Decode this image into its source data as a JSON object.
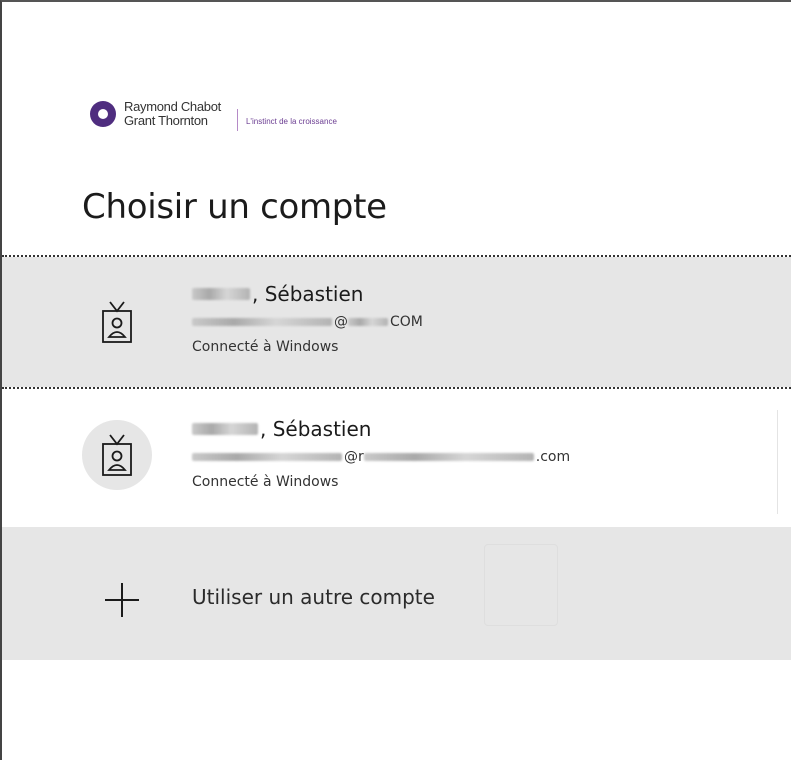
{
  "logo": {
    "line1": "Raymond Chabot",
    "line2": "Grant Thornton",
    "tagline": "L'instinct de la croissance"
  },
  "title": "Choisir un compte",
  "accounts": [
    {
      "name_suffix": ", Sébastien",
      "email_at": "@",
      "email_domain": " COM",
      "status": "Connecté à Windows",
      "selected": true
    },
    {
      "name_suffix": ", Sébastien",
      "email_at": "@r",
      "email_domain": ".com",
      "status": "Connecté à Windows",
      "selected": false
    }
  ],
  "add_account": {
    "label": "Utiliser un autre compte",
    "icon": "plus-icon"
  },
  "icons": {
    "avatar": "badge-icon",
    "logo": "rcgt-logo-icon"
  },
  "colors": {
    "brand": "#4f2d7f",
    "selected_bg": "#e6e6e6"
  }
}
